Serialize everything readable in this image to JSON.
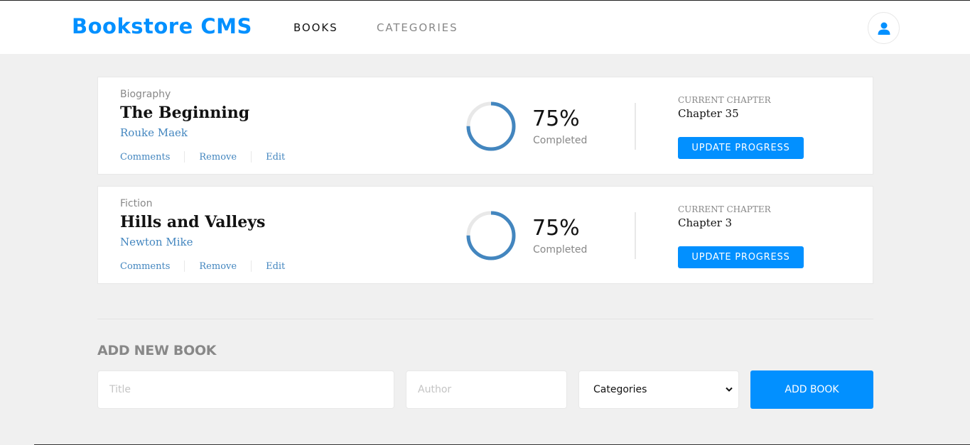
{
  "header": {
    "logo": "Bookstore CMS",
    "nav": [
      {
        "label": "BOOKS",
        "active": true
      },
      {
        "label": "CATEGORIES",
        "active": false
      }
    ],
    "user_icon": "user-icon"
  },
  "books": [
    {
      "category": "Biography",
      "title": "The Beginning",
      "author": "Rouke Maek",
      "actions": [
        "Comments",
        "Remove",
        "Edit"
      ],
      "progress_percent": 75,
      "progress_label": "75%",
      "completed_label": "Completed",
      "current_chapter_label": "CURRENT CHAPTER",
      "current_chapter": "Chapter 35",
      "update_button": "UPDATE PROGRESS"
    },
    {
      "category": "Fiction",
      "title": "Hills and Valleys",
      "author": "Newton Mike",
      "actions": [
        "Comments",
        "Remove",
        "Edit"
      ],
      "progress_percent": 75,
      "progress_label": "75%",
      "completed_label": "Completed",
      "current_chapter_label": "CURRENT CHAPTER",
      "current_chapter": "Chapter 3",
      "update_button": "UPDATE PROGRESS"
    }
  ],
  "form": {
    "title": "ADD NEW BOOK",
    "title_placeholder": "Title",
    "author_placeholder": "Author",
    "category_selected": "Categories",
    "submit_label": "ADD BOOK"
  },
  "colors": {
    "primary": "#0290ff",
    "link": "#4386bf",
    "muted": "#888888",
    "ring_track": "#e8e8e8"
  }
}
